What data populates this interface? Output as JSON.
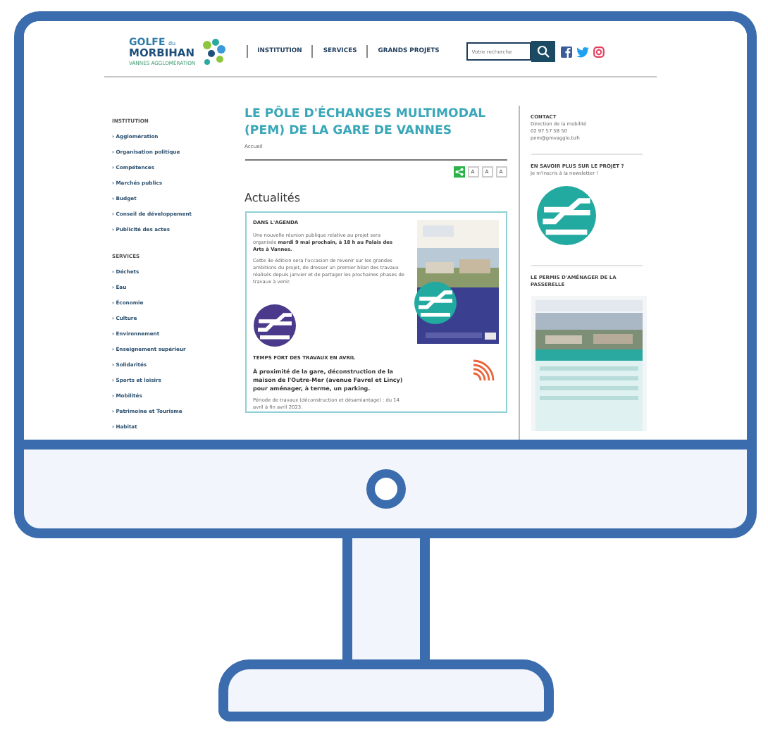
{
  "header": {
    "logo": {
      "line1": "GOLFE",
      "small": "du",
      "line2": "MORBIHAN",
      "tagline": "VANNES AGGLOMÉRATION"
    },
    "nav": [
      "INSTITUTION",
      "SERVICES",
      "GRANDS PROJETS"
    ],
    "search": {
      "placeholder": "Votre recherche"
    }
  },
  "sidebar": {
    "sections": [
      {
        "title": "INSTITUTION",
        "items": [
          "› Agglomération",
          "› Organisation politique",
          "› Compétences",
          "› Marchés publics",
          "› Budget",
          "› Conseil de développement",
          "› Publicité des actes"
        ]
      },
      {
        "title": "SERVICES",
        "items": [
          "› Déchets",
          "› Eau",
          "› Économie",
          "› Culture",
          "› Environnement",
          "› Enseignement supérieur",
          "› Solidarités",
          "› Sports et loisirs",
          "› Mobilités",
          "› Patrimoine et Tourisme",
          "› Habitat"
        ]
      }
    ]
  },
  "main": {
    "title": "LE PÔLE D'ÉCHANGES MULTIMODAL (PEM) DE LA GARE DE VANNES",
    "breadcrumb": "Accueil",
    "font_buttons": [
      "A",
      "A",
      "A"
    ],
    "heading": "Actualités",
    "news": [
      {
        "label": "DANS L'AGENDA",
        "kind": "agenda",
        "paragraphs": [
          "Une nouvelle réunion publique relative au projet sera organisée **mardi 9 mai prochain, à 18 h au Palais des Arts à Vannes.**",
          "Cette 3e édition sera l'occasion de revenir sur les grandes ambitions du projet, de dresser un premier bilan des travaux réalisés depuis janvier et de partager les prochaines phases de travaux à venir."
        ]
      },
      {
        "label": "TEMPS FORT DES TRAVAUX EN AVRIL",
        "kind": "works",
        "paragraphs": [
          "**À proximité de la gare, déconstruction de la maison de l'Outre-Mer (avenue Favrel et Lincy) pour aménager, à terme, un parking.**",
          "Période de travaux (déconstruction et désamiantage) : du 14 avril à fin avril 2023."
        ]
      }
    ]
  },
  "aside": {
    "contact_title": "CONTACT",
    "contact_lines": [
      "Direction de la mobilité",
      "02 97 57 58 50",
      "pem@gmvagglo.bzh"
    ],
    "more_title": "EN SAVOIR PLUS SUR LE PROJET ?",
    "newsletter": "Je m'inscris à la newsletter !",
    "permit_title": "LE PERMIS D'AMÉNAGER DE LA PASSERELLE"
  }
}
